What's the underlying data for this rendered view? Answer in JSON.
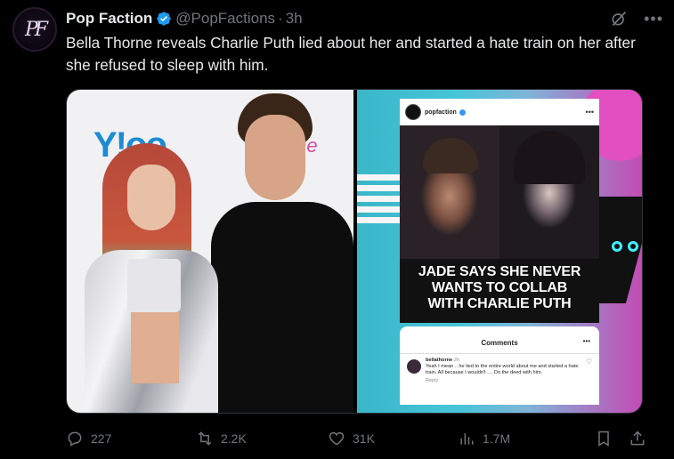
{
  "account": {
    "name": "Pop Faction",
    "handle": "@PopFactions",
    "time": "3h",
    "avatar_monogram": "PF"
  },
  "tweet": {
    "text": "Bella Thorne reveals Charlie Puth lied about her and started a hate train on her after she refused to sleep with him."
  },
  "media": {
    "backdrop_text_left": "Y!oo",
    "backdrop_text_right": "One",
    "ig_post": {
      "user": "popfaction",
      "headline": [
        "JADE SAYS SHE NEVER",
        "WANTS TO COLLAB",
        "WITH CHARLIE PUTH"
      ]
    },
    "comments_panel": {
      "title": "Comments",
      "comment_user": "bellathorne",
      "comment_time": "2h",
      "comment_text": "Yeah I mean .. he lied to the entire world about me and started a hate train. All because I wouldn't .... Do the deed with him.",
      "reply_label": "Reply"
    }
  },
  "actions": {
    "replies": "227",
    "reposts": "2.2K",
    "likes": "31K",
    "views": "1.7M"
  },
  "colors": {
    "background": "#000000",
    "text_primary": "#e7e9ea",
    "text_secondary": "#71767b",
    "verified_blue": "#1d9bf0"
  }
}
